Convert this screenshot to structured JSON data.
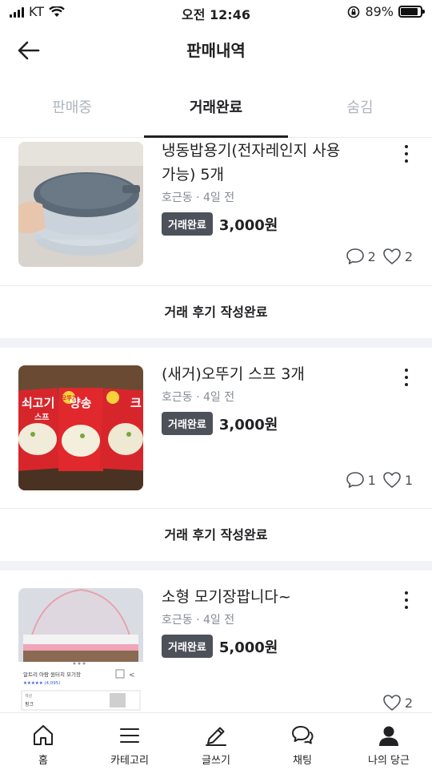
{
  "status_bar": {
    "carrier": "KT",
    "time": "오전 12:46",
    "battery": "89%",
    "battery_level": 0.89
  },
  "header": {
    "title": "판매내역"
  },
  "tabs": [
    {
      "label": "판매중"
    },
    {
      "label": "거래완료"
    },
    {
      "label": "숨김"
    }
  ],
  "items": [
    {
      "title_line1": "냉동밥용기(전자레인지 사용",
      "title_line2": "가능) 5개",
      "meta": "호근동 · 4일 전",
      "badge": "거래완료",
      "price": "3,000원",
      "chats": "2",
      "likes": "2",
      "review": "거래 후기 작성완료"
    },
    {
      "title_line1": "(새거)오뚜기 스프 3개",
      "title_line2": "",
      "meta": "호근동 · 4일 전",
      "badge": "거래완료",
      "price": "3,000원",
      "chats": "1",
      "likes": "1",
      "review": "거래 후기 작성완료"
    },
    {
      "title_line1": "소형 모기장팝니다~",
      "title_line2": "",
      "meta": "호근동 · 4일 전",
      "badge": "거래완료",
      "price": "5,000원",
      "chats": "",
      "likes": "2",
      "review": ""
    }
  ],
  "thumb_text": {
    "soup_1": "쇠고기",
    "soup_2": "양송",
    "soup_3": "크",
    "soup_small": "스프",
    "brand": "오뚜기",
    "net_product": "알트리 아람 원터치 모기장",
    "net_rating": "★★★★★ (4,095)",
    "net_option_label": "색상",
    "net_option_value": "핑크"
  },
  "nav": [
    {
      "label": "홈",
      "icon": "home-icon"
    },
    {
      "label": "카테고리",
      "icon": "menu-icon"
    },
    {
      "label": "글쓰기",
      "icon": "pencil-icon"
    },
    {
      "label": "채팅",
      "icon": "chat-icon"
    },
    {
      "label": "나의 당근",
      "icon": "user-icon"
    }
  ],
  "colors": {
    "text": "#212124",
    "badge_bg": "#4d5159",
    "muted": "#868b94",
    "tab_inactive": "#adb5bd"
  }
}
